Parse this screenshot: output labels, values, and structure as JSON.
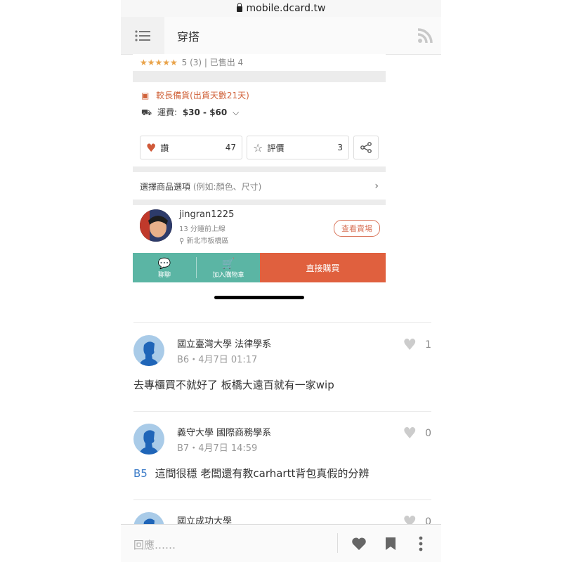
{
  "browser": {
    "url": "mobile.dcard.tw"
  },
  "header": {
    "title": "穿搭"
  },
  "product": {
    "rating_stars": "★★★★★",
    "rating_text": "5 (3) | 已售出 4",
    "ship_warning": "較長備貨(出貨天數21天)",
    "shipping_label": "運費:",
    "shipping_value": "$30 - $60",
    "like_label": "讚",
    "like_count": "47",
    "review_label": "評價",
    "review_count": "3",
    "options_label": "選擇商品選項",
    "options_hint": "(例如:顏色、尺寸)",
    "seller_name": "jingran1225",
    "seller_online": "13 分鐘前上線",
    "seller_location": "新北市板橋區",
    "store_button": "查看賣場",
    "chat_label": "聊聊",
    "cart_label": "加入購物車",
    "buy_label": "直接購買"
  },
  "comments": [
    {
      "school": "國立臺灣大學 法律學系",
      "meta": "B6・4月7日 01:17",
      "likes": "1",
      "floor_ref": "",
      "body": "去專櫃買不就好了 板橋大遠百就有一家wip"
    },
    {
      "school": "義守大學 國際商務學系",
      "meta": "B7・4月7日 14:59",
      "likes": "0",
      "floor_ref": "B5",
      "body": "這間很穩 老闆還有教carhartt背包真假的分辨"
    },
    {
      "school": "國立成功大學",
      "meta": "",
      "likes": "0",
      "floor_ref": "",
      "body": ""
    }
  ],
  "bottom": {
    "reply_placeholder": "回應……"
  }
}
